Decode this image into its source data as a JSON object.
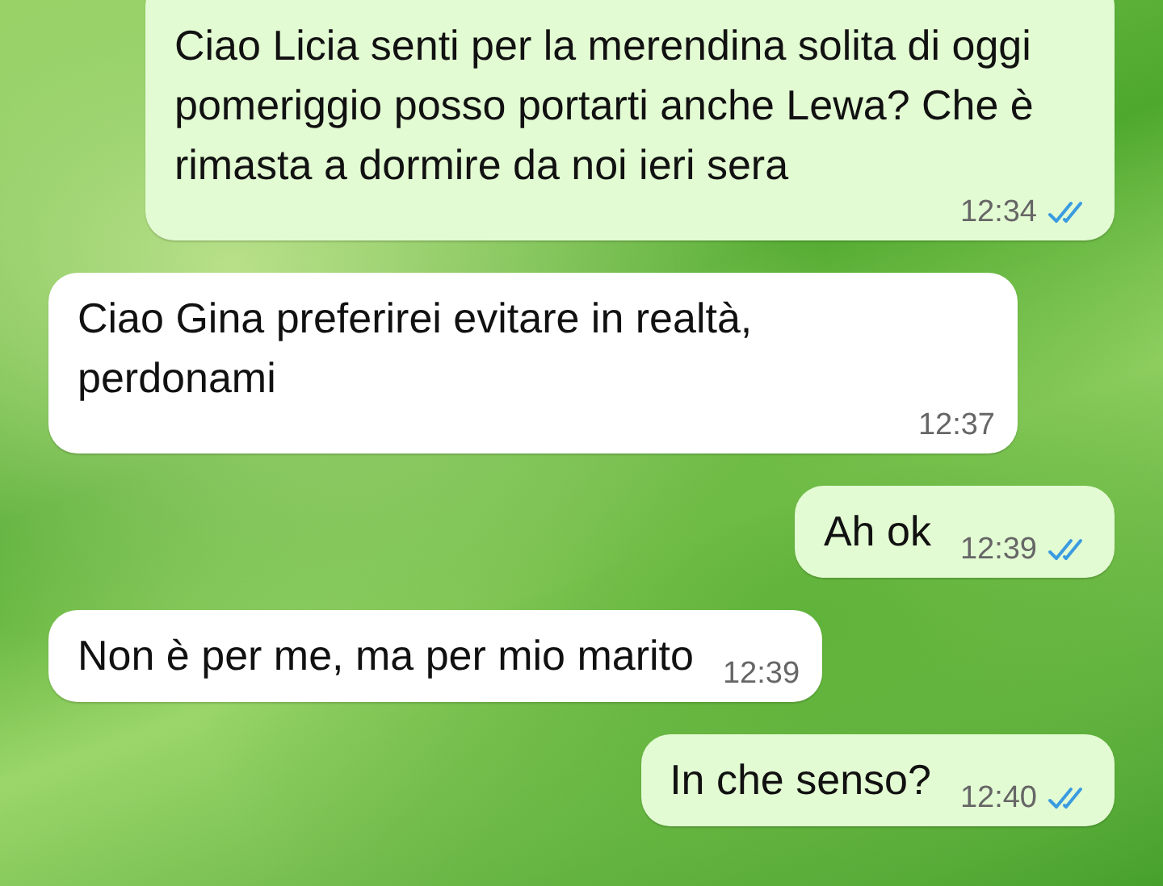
{
  "messages": [
    {
      "kind": "outgoing",
      "text": "Ciao Licia senti per la merendina solita di oggi pomeriggio posso portarti anche Lewa? Che è rimasta a dormire da noi ieri sera",
      "time": "12:34",
      "read": true
    },
    {
      "kind": "incoming",
      "text": "Ciao Gina preferirei evitare in realtà, perdonami",
      "time": "12:37"
    },
    {
      "kind": "outgoing",
      "text": "Ah ok",
      "time": "12:39",
      "read": true
    },
    {
      "kind": "incoming",
      "text": "Non è per me, ma per mio marito",
      "time": "12:39"
    },
    {
      "kind": "outgoing",
      "text": "In che senso?",
      "time": "12:40",
      "read": true
    }
  ]
}
